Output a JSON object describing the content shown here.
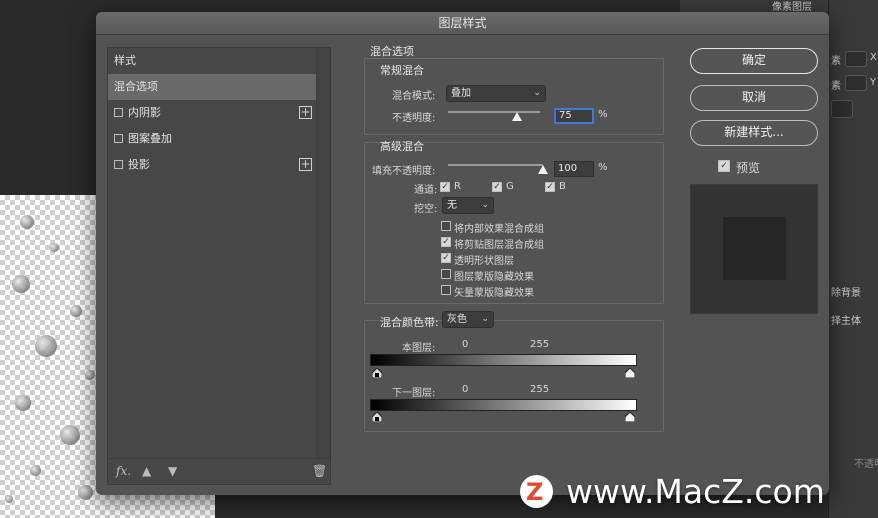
{
  "dialog": {
    "title": "图层样式"
  },
  "styles_list": {
    "header": "样式",
    "items": [
      {
        "label": "混合选项",
        "checkbox": false,
        "plus": false,
        "selected": true
      },
      {
        "label": "内阴影",
        "checkbox": true,
        "plus": true,
        "selected": false
      },
      {
        "label": "图案叠加",
        "checkbox": true,
        "plus": false,
        "selected": false
      },
      {
        "label": "投影",
        "checkbox": true,
        "plus": true,
        "selected": false
      }
    ],
    "footer": {
      "fx_label": "fx."
    }
  },
  "blend_options": {
    "title": "混合选项",
    "general": {
      "title": "常规混合",
      "mode_label": "混合模式:",
      "mode_value": "叠加",
      "opacity_label": "不透明度:",
      "opacity_value": "75",
      "opacity_percent": 75,
      "percent_sign": "%"
    },
    "advanced": {
      "title": "高级混合",
      "fill_label": "填充不透明度:",
      "fill_value": "100",
      "fill_percent": 100,
      "percent_sign": "%",
      "channels_label": "通道:",
      "channel_r": "R",
      "channel_g": "G",
      "channel_b": "B",
      "knockout_label": "挖空:",
      "knockout_value": "无",
      "options": [
        {
          "label": "将内部效果混合成组",
          "checked": false
        },
        {
          "label": "将剪贴图层混合成组",
          "checked": true
        },
        {
          "label": "透明形状图层",
          "checked": true
        },
        {
          "label": "图层蒙版隐藏效果",
          "checked": false
        },
        {
          "label": "矢量蒙版隐藏效果",
          "checked": false
        }
      ]
    },
    "blend_if": {
      "label": "混合颜色带:",
      "value": "灰色",
      "this_layer_label": "本图层:",
      "this_layer_min": "0",
      "this_layer_max": "255",
      "under_layer_label": "下一图层:",
      "under_layer_min": "0",
      "under_layer_max": "255"
    }
  },
  "buttons": {
    "ok": "确定",
    "cancel": "取消",
    "new_style": "新建样式...",
    "preview_label": "预览"
  },
  "background_panel": {
    "pixel_layer": "像素图层",
    "x_label": "X",
    "y_label": "Y",
    "su": "素",
    "remove_bg": "除背景",
    "select_subject": "择主体",
    "opacity_short": "不透明"
  },
  "watermark": {
    "text": "www.MacZ.com",
    "logo_letter": "Z"
  }
}
